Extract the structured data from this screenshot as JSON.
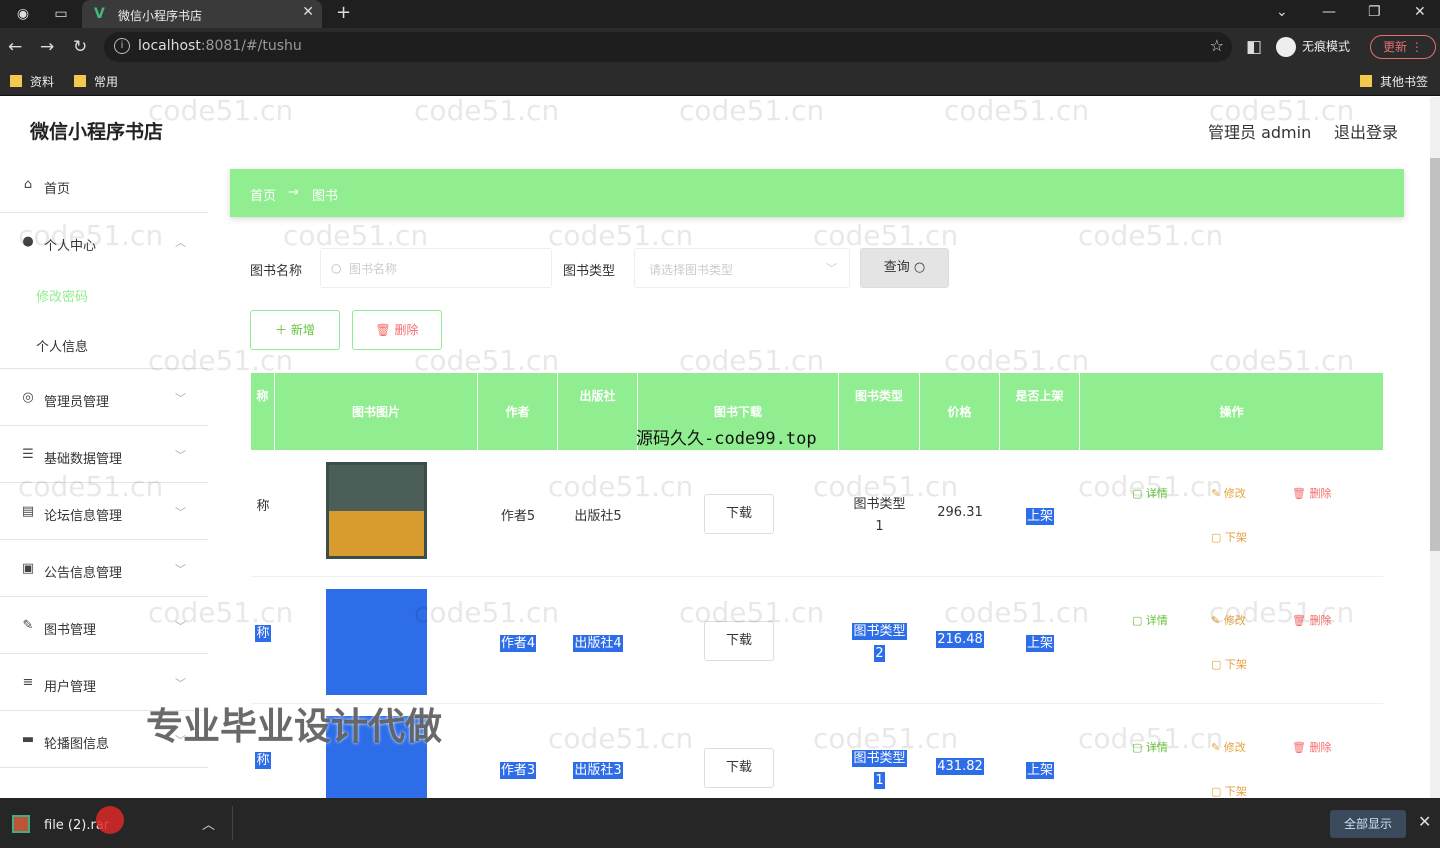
{
  "browser": {
    "tab_title": "微信小程序书店",
    "url_host": "localhost",
    "url_rest": ":8081/#/tushu",
    "incognito_label": "无痕模式",
    "update_label": "更新",
    "bookmarks": [
      "资料",
      "常用"
    ],
    "other_bookmarks": "其他书签"
  },
  "header": {
    "brand": "微信小程序书店",
    "user": "管理员 admin",
    "logout": "退出登录"
  },
  "sidebar": {
    "items": [
      {
        "label": "首页",
        "icon": "home-icon"
      },
      {
        "label": "个人中心",
        "icon": "user-icon"
      },
      {
        "label": "管理员管理",
        "icon": "compass-icon"
      },
      {
        "label": "基础数据管理",
        "icon": "sliders-icon"
      },
      {
        "label": "论坛信息管理",
        "icon": "document-icon"
      },
      {
        "label": "公告信息管理",
        "icon": "ticket-icon"
      },
      {
        "label": "图书管理",
        "icon": "edit-icon"
      },
      {
        "label": "用户管理",
        "icon": "menu-icon"
      },
      {
        "label": "轮播图信息",
        "icon": "chat-icon"
      }
    ],
    "sub_items": [
      "修改密码",
      "个人信息"
    ]
  },
  "breadcrumb": {
    "home": "首页",
    "arrow": "→",
    "current": "图书"
  },
  "search": {
    "name_label": "图书名称",
    "name_placeholder": "图书名称",
    "type_label": "图书类型",
    "type_placeholder": "请选择图书类型",
    "query_label": "查询"
  },
  "actions": {
    "add_label": "新增",
    "delete_label": "删除"
  },
  "table": {
    "headers": [
      "称",
      "图书图片",
      "作者",
      "出版社",
      "图书下载",
      "图书类型",
      "价格",
      "是否上架",
      "操作"
    ],
    "rows": [
      {
        "name": "称",
        "author": "作者5",
        "publisher": "出版社5",
        "download": "下载",
        "type": "图书类型",
        "type_num": "1",
        "price": "296.31",
        "status": "上架",
        "selected": false
      },
      {
        "name": "称",
        "author": "作者4",
        "publisher": "出版社4",
        "download": "下载",
        "type": "图书类型",
        "type_num": "2",
        "price": "216.48",
        "status": "上架",
        "selected": true
      },
      {
        "name": "称",
        "author": "作者3",
        "publisher": "出版社3",
        "download": "下载",
        "type": "图书类型",
        "type_num": "1",
        "price": "431.82",
        "status": "上架",
        "selected": true
      }
    ],
    "op_labels": {
      "detail": "详情",
      "edit": "修改",
      "remove": "删除",
      "off": "下架"
    }
  },
  "overlays": {
    "code_text": "源码久久-code99.top",
    "promo_text": "专业毕业设计代做",
    "watermark": "code51.cn"
  },
  "download_bar": {
    "file_name": "file (2).rar",
    "show_all": "全部显示"
  }
}
